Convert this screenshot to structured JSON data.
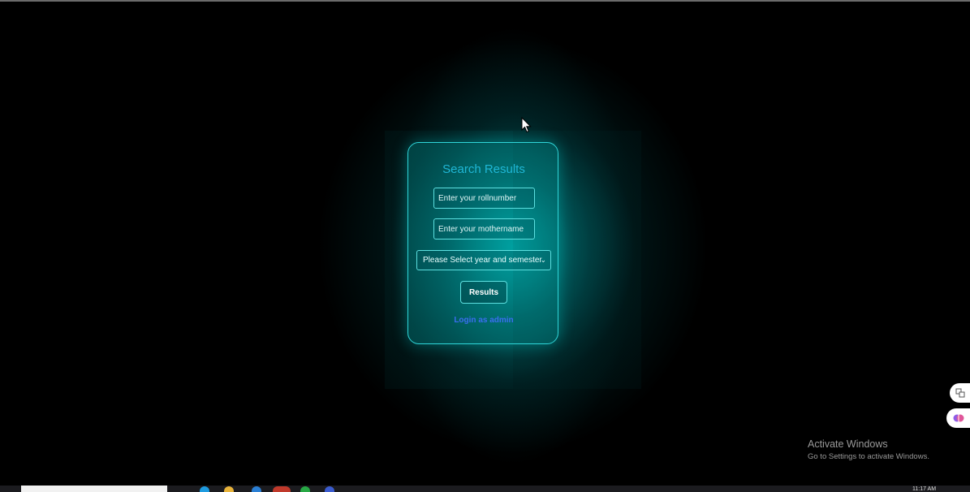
{
  "card": {
    "title": "Search Results",
    "rollnumber_placeholder": "Enter your rollnumber",
    "mothername_placeholder": "Enter your mothername",
    "select_value": "Please Select year and semester",
    "results_button": "Results",
    "admin_link": "Login as admin"
  },
  "watermark": {
    "line1": "Activate Windows",
    "line2": "Go to Settings to activate Windows."
  },
  "taskbar": {
    "clock": "11:17 AM"
  },
  "colors": {
    "background": "#000000",
    "accent_teal": "#2fd6d9",
    "title": "#1fb7d6",
    "link": "#3a6ef0"
  },
  "icons": {
    "select_chevron": "chevron-down-icon",
    "side_top": "translate-icon",
    "side_bottom": "brain-icon",
    "cursor": "mouse-pointer-icon"
  }
}
